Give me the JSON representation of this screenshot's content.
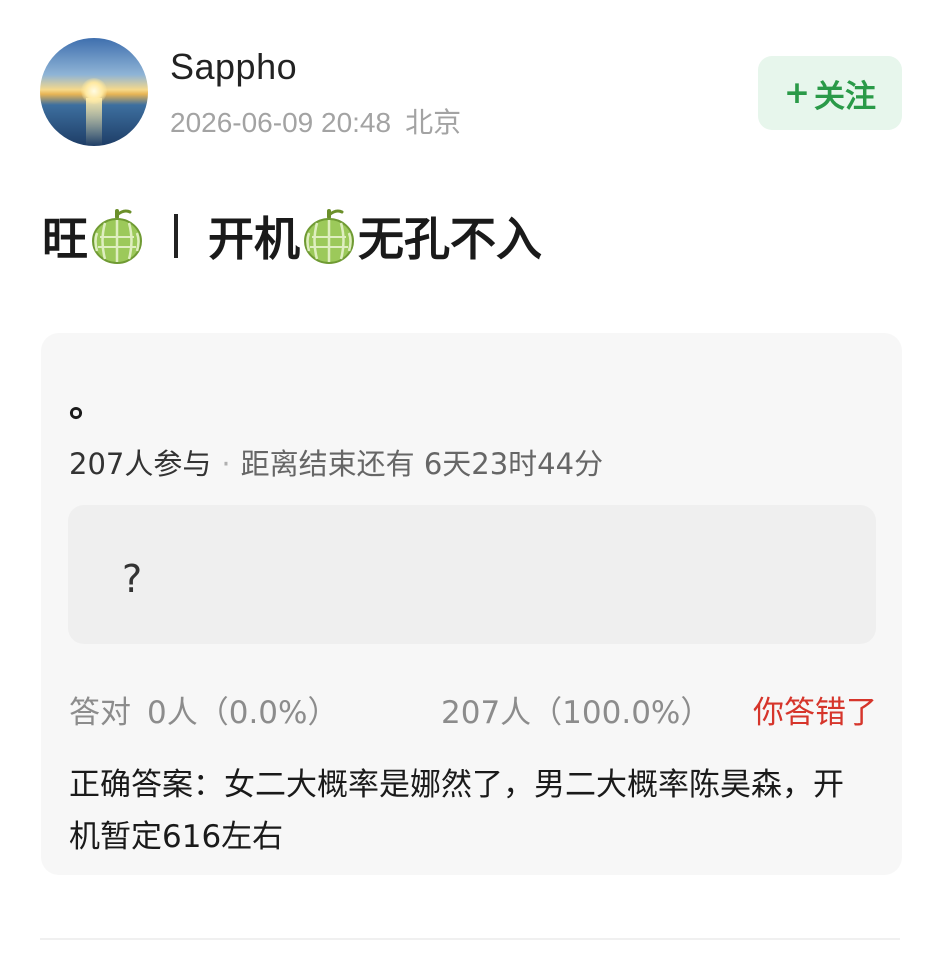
{
  "post": {
    "username": "Sappho",
    "timestamp": "2026-06-09 20:48",
    "location": "北京",
    "follow_label": "关注",
    "follow_plus": "+",
    "title_part1": "旺",
    "title_separator": "丨",
    "title_part2": "开机",
    "title_part3": "无孔不入"
  },
  "quiz": {
    "question": "。",
    "participants": "207人参与",
    "dot": "·",
    "time_left_label": "距离结束还有",
    "time_left": "6天23时44分",
    "option_label": "?",
    "correct_label": "答对",
    "correct_stat": "0人（0.0%）",
    "wrong_stat": "207人（100.0%）",
    "verdict": "你答错了",
    "answer_text": "正确答案：女二大概率是娜然了，男二大概率陈昊森，开机暂定616左右"
  },
  "colors": {
    "follow_bg": "#e7f6ec",
    "follow_text": "#2a9a48",
    "verdict": "#d6352b",
    "card_bg": "#f7f7f7"
  }
}
